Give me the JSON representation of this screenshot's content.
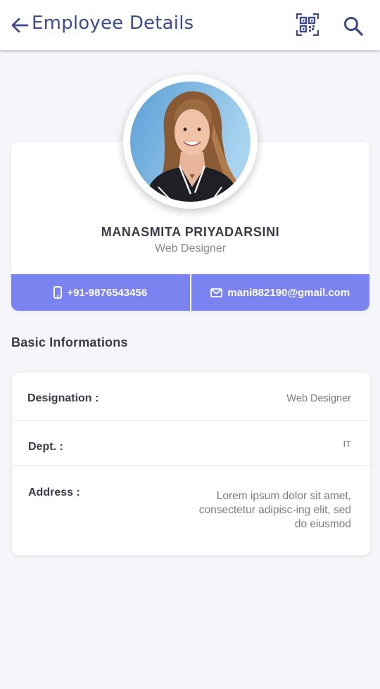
{
  "header": {
    "title": "Employee Details",
    "back_icon": "arrow-left-icon",
    "qr_icon": "qr-code-icon",
    "search_icon": "search-icon",
    "accent_color": "#3d4a8c"
  },
  "profile": {
    "name": "MANASMITA PRIYADARSINI",
    "role": "Web Designer",
    "avatar": "employee-photo",
    "phone": "+91-9876543456",
    "email": "mani882190@gmail.com",
    "contact_bar_color": "#7a83f0"
  },
  "basic_info": {
    "section_title": "Basic Informations",
    "rows": [
      {
        "label": "Designation :",
        "value": "Web Designer"
      },
      {
        "label": "Dept. :",
        "value": "IT"
      },
      {
        "label": "Address :",
        "value": "Lorem ipsum dolor sit amet, consectetur adipisc-ing elit, sed do eiusmod"
      }
    ]
  }
}
